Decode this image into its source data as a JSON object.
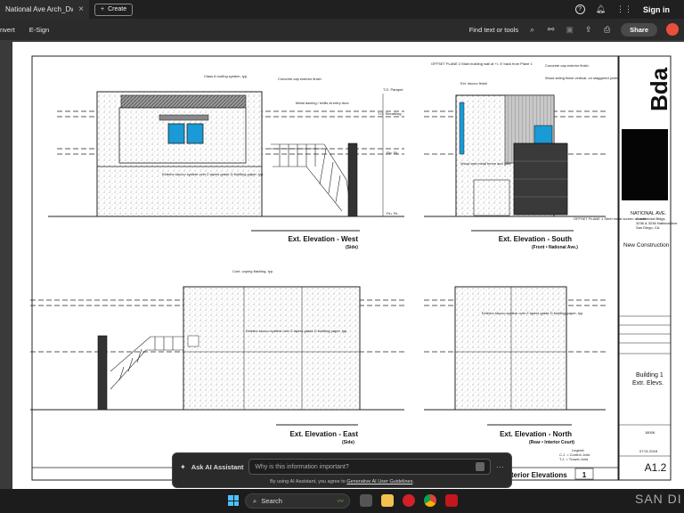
{
  "window": {
    "tab_title": "National Ave Arch_Dwg...",
    "create_label": "Create",
    "signin_label": "Sign in"
  },
  "toolbar": {
    "convert_label": "nvert",
    "esign_label": "E-Sign",
    "find_label": "Find text or tools",
    "share_label": "Share"
  },
  "drawing": {
    "elevations": [
      {
        "title": "Ext. Elevation - West",
        "subtitle": "(Side)"
      },
      {
        "title": "Ext. Elevation - South",
        "subtitle": "(Front • National Ave.)"
      },
      {
        "title": "Ext. Elevation - East",
        "subtitle": "(Side)"
      },
      {
        "title": "Ext. Elevation - North",
        "subtitle": "(Rear • Interior Court)"
      }
    ],
    "sheet_title_partial": "terior Elevations",
    "sheet_number_box": "1",
    "levels": {
      "parapet": "T.O. Parapet",
      "sheathing": "T.O. Sheathing",
      "flr2": "Fin. Flr.",
      "flr1": "Fin. Flr."
    },
    "notes": {
      "west_roof": "Class A roofing system, typ.",
      "west_cap": "Concrete cap exterior finish",
      "west_awning": "Metal awning / trellis at entry door",
      "west_stucco": "Exterior stucco system over 2 layers grade D building paper, typ.",
      "south_offset": "OFFSET PLANE 2 Main building wall at +/- 5' back from Plane 1",
      "south_stucco": "Ext. stucco finish",
      "south_cap": "Concrete cap exterior finish",
      "south_siding": "Wood siding finish vertical, on staggered joints",
      "south_fence": "Wood and metal fence and gate",
      "south_plane1": "OFFSET PLANE 1 Steel metal screen on wall",
      "east_coping": "Cont. coping flashing, typ.",
      "east_stucco": "Exterior stucco system over 2 layers grade D building paper, typ.",
      "north_stucco": "Exterior stucco system over 2 layers grade D building paper, typ."
    },
    "legend_lines": [
      "Legend:",
      "C.J. = Control Joint",
      "T.J. = Trowel Joint"
    ]
  },
  "titleblock": {
    "firm_logo": "Bda",
    "project_name": "NATIONAL AVE.",
    "project_lines": [
      "Commercial Bldgs.",
      "3236 & 3236 National Ave.",
      "San Diego, CA"
    ],
    "phase": "New Construction",
    "building": "Building 1",
    "sheet_desc": "Extr. Elevs.",
    "job_no": "18006",
    "date": "07.01.2018",
    "sheet_number": "A1.2"
  },
  "ai_assistant": {
    "label": "Ask AI Assistant",
    "placeholder": "Why is this information important?",
    "disclaimer_prefix": "By using AI Assistant, you agree to ",
    "disclaimer_link": "Generative AI User Guidelines",
    "disclaimer_suffix": "."
  },
  "taskbar": {
    "search_label": "Search",
    "overflow_text": "SAN DI"
  },
  "colors": {
    "window_blue": "#1a9ad6",
    "avatar": "#e8503a",
    "dark_panel": "#2b2b2b"
  }
}
